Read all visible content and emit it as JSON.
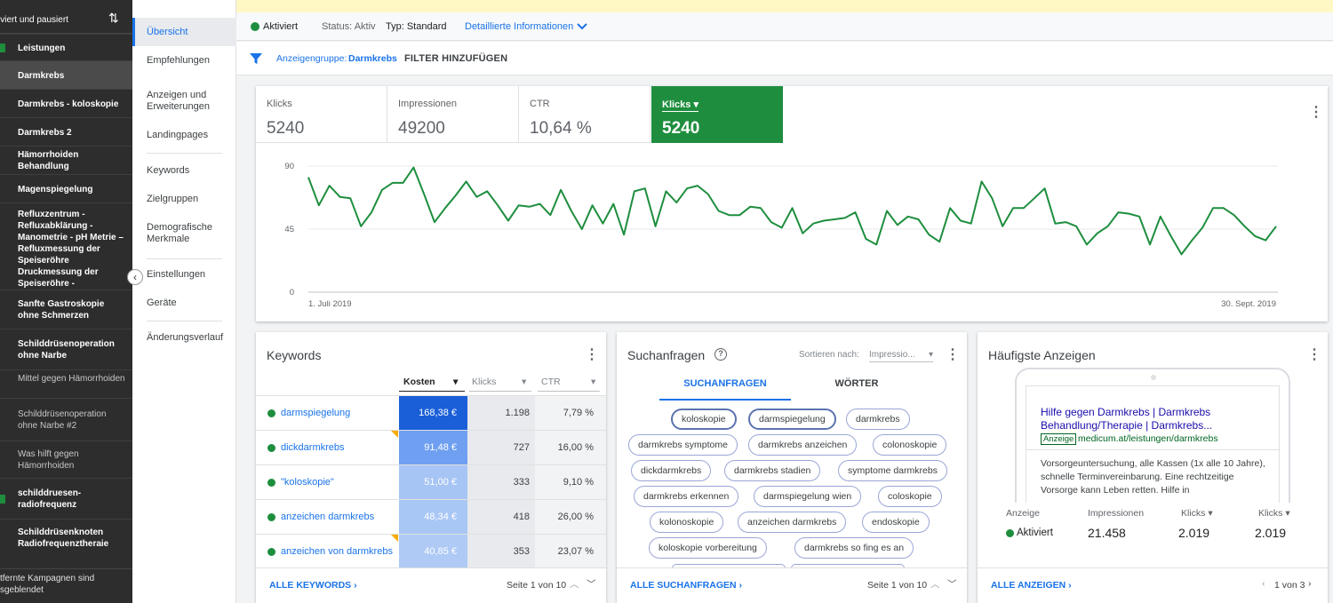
{
  "sidebar": {
    "top_label": "iviert und pausiert",
    "campaigns": [
      {
        "label": "Leistungen",
        "style": "bold",
        "icon": true
      },
      {
        "label": "Darmkrebs",
        "style": "sel"
      },
      {
        "label": "Darmkrebs - koloskopie",
        "style": "bold"
      },
      {
        "label": "Darmkrebs 2",
        "style": "bold"
      },
      {
        "label": "Hämorrhoiden Behandlung",
        "style": "bold"
      },
      {
        "label": "Magenspiegelung",
        "style": "bold"
      },
      {
        "label": "Refluxzentrum - Refluxabklärung - Manometrie - pH Metrie – Refluxmessung der Speiseröhre Druckmessung der Speiseröhre -",
        "style": "bold"
      },
      {
        "label": "Sanfte Gastroskopie ohne Schmerzen",
        "style": "bold"
      },
      {
        "label": "Schilddrüsenoperation ohne Narbe",
        "style": "bold"
      },
      {
        "label": "Mittel gegen Hämorrhoiden",
        "style": "dim"
      },
      {
        "label": "Schilddrüsenoperation ohne Narbe #2",
        "style": "dim"
      },
      {
        "label": "Was hilft gegen Hämorrhoiden",
        "style": "dim"
      },
      {
        "label": "schilddruesen-radiofrequenz",
        "style": "bold",
        "icon": true
      },
      {
        "label": "Schilddrüsenknoten Radiofrequenztheraie",
        "style": "bold"
      }
    ],
    "bottom_label": "tfernte Kampagnen sind sgeblendet"
  },
  "nav": {
    "items": [
      "Übersicht",
      "Empfehlungen",
      "Anzeigen und Erweiterungen",
      "Landingpages",
      "Keywords",
      "Zielgruppen",
      "Demografische Merkmale",
      "Einstellungen",
      "Geräte",
      "Änderungsverlauf"
    ]
  },
  "status": {
    "state": "Aktiviert",
    "status_text": "Status: Aktiv",
    "type_text": "Typ: Standard",
    "details_link": "Detaillierte Informationen"
  },
  "filter": {
    "adgroup_label": "Anzeigengruppe:",
    "adgroup_value": "Darmkrebs",
    "add_filter": "FILTER HINZUFÜGEN"
  },
  "metrics": [
    {
      "label": "Klicks",
      "value": "5240"
    },
    {
      "label": "Impressionen",
      "value": "49200"
    },
    {
      "label": "CTR",
      "value": "10,64 %"
    },
    {
      "label": "Klicks",
      "value": "5240",
      "selected": true
    }
  ],
  "chart_data": {
    "type": "line",
    "ylim": [
      0,
      90
    ],
    "yticks": [
      "90",
      "45",
      "0"
    ],
    "x_start_label": "1. Juli 2019",
    "x_end_label": "30. Sept. 2019",
    "color": "#1e8e3e",
    "series": [
      {
        "values": [
          82,
          62,
          76,
          68,
          67,
          47,
          57,
          73,
          78,
          78,
          89,
          70,
          50,
          60,
          69,
          79,
          68,
          72,
          62,
          51,
          62,
          61,
          63,
          55,
          73,
          58,
          45,
          62,
          49,
          63,
          41,
          72,
          74,
          47,
          72,
          64,
          74,
          76,
          70,
          58,
          55,
          55,
          61,
          60,
          50,
          46,
          60,
          42,
          49,
          51,
          52,
          53,
          57,
          38,
          34,
          58,
          48,
          54,
          52,
          41,
          36,
          60,
          51,
          49,
          79,
          67,
          47,
          60,
          60,
          67,
          74,
          49,
          50,
          47,
          34,
          42,
          47,
          57,
          56,
          54,
          34,
          54,
          40,
          27,
          37,
          46,
          60,
          60,
          55,
          47,
          40,
          37,
          47
        ]
      }
    ]
  },
  "keywords": {
    "title": "Keywords",
    "columns": [
      "Kosten",
      "Klicks",
      "CTR"
    ],
    "rows": [
      {
        "kw": "darmspiegelung",
        "cost": "168,38 €",
        "clicks": "1.198",
        "ctr": "7,79 %",
        "bg": "#1a5fd8",
        "flag": false
      },
      {
        "kw": "dickdarmkrebs",
        "cost": "91,48 €",
        "clicks": "727",
        "ctr": "16,00 %",
        "bg": "#6f9ff0",
        "flag": true
      },
      {
        "kw": "\"koloskopie\"",
        "cost": "51,00 €",
        "clicks": "333",
        "ctr": "9,10 %",
        "bg": "#a7c5f4",
        "flag": false
      },
      {
        "kw": "anzeichen darmkrebs",
        "cost": "48,34 €",
        "clicks": "418",
        "ctr": "26,00 %",
        "bg": "#a9c7f5",
        "flag": false
      },
      {
        "kw": "anzeichen von darmkrebs",
        "cost": "40,85 €",
        "clicks": "353",
        "ctr": "23,07 %",
        "bg": "#aecaf5",
        "flag": true
      }
    ],
    "footer_link": "ALLE KEYWORDS",
    "pagination": "Seite 1 von 10"
  },
  "queries": {
    "title": "Suchanfragen",
    "sort_label": "Sortieren nach:",
    "sort_value": "Impressio...",
    "tabs": [
      "SUCHANFRAGEN",
      "WÖRTER"
    ],
    "chips": [
      [
        "koloskopie",
        "darmspiegelung",
        "darmkrebs"
      ],
      [
        "darmkrebs symptome",
        "darmkrebs anzeichen",
        "colonoskopie"
      ],
      [
        "dickdarmkrebs",
        "darmkrebs stadien",
        "symptome darmkrebs"
      ],
      [
        "darmkrebs erkennen",
        "darmspiegelung wien",
        "coloskopie"
      ],
      [
        "kolonoskopie",
        "anzeichen darmkrebs",
        "endoskopie"
      ],
      [
        "koloskopie vorbereitung",
        "darmkrebs so fing es an"
      ]
    ],
    "footer_link": "ALLE SUCHANFRAGEN",
    "pagination": "Seite 1 von 10"
  },
  "ads": {
    "title": "Häufigste Anzeigen",
    "headline": "Hilfe gegen Darmkrebs | Darmkrebs Behandlung/Therapie | Darmkrebs...",
    "badge": "Anzeige",
    "url": "medicum.at/leistungen/darmkrebs",
    "description": "Vorsorgeuntersuchung, alle Kassen (1x alle 10 Jahre), schnelle Terminvereinbarung. Eine rechtzeitige Vorsorge kann Leben retten. Hilfe in",
    "stats_headers": [
      "Anzeige",
      "Impressionen",
      "Klicks",
      "Klicks"
    ],
    "stats_values": [
      "Aktiviert",
      "21.458",
      "2.019",
      "2.019"
    ],
    "footer_link": "ALLE ANZEIGEN",
    "pagination": "1 von 3"
  }
}
